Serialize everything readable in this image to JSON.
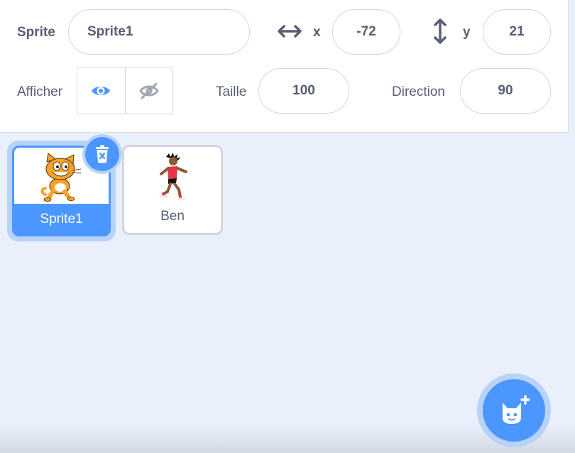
{
  "sprite_info": {
    "sprite_label": "Sprite",
    "sprite_name": "Sprite1",
    "x_label": "x",
    "x_value": "-72",
    "y_label": "y",
    "y_value": "21",
    "show_label": "Afficher",
    "visible": true,
    "size_label": "Taille",
    "size_value": "100",
    "direction_label": "Direction",
    "direction_value": "90"
  },
  "sprites": [
    {
      "name": "Sprite1",
      "selected": true,
      "icon": "cat-sprite"
    },
    {
      "name": "Ben",
      "selected": false,
      "icon": "ben-runner-sprite"
    }
  ],
  "colors": {
    "accent": "#4c97ff",
    "accent_light": "#b8d2f8",
    "text": "#575e75",
    "panel_bg": "#e9f0fb"
  },
  "icons": {
    "delete": "trash-icon",
    "add_sprite": "choose-sprite-icon",
    "show": "eye-icon",
    "hide": "eye-slash-icon",
    "x_axis": "horizontal-arrows-icon",
    "y_axis": "vertical-arrows-icon"
  }
}
